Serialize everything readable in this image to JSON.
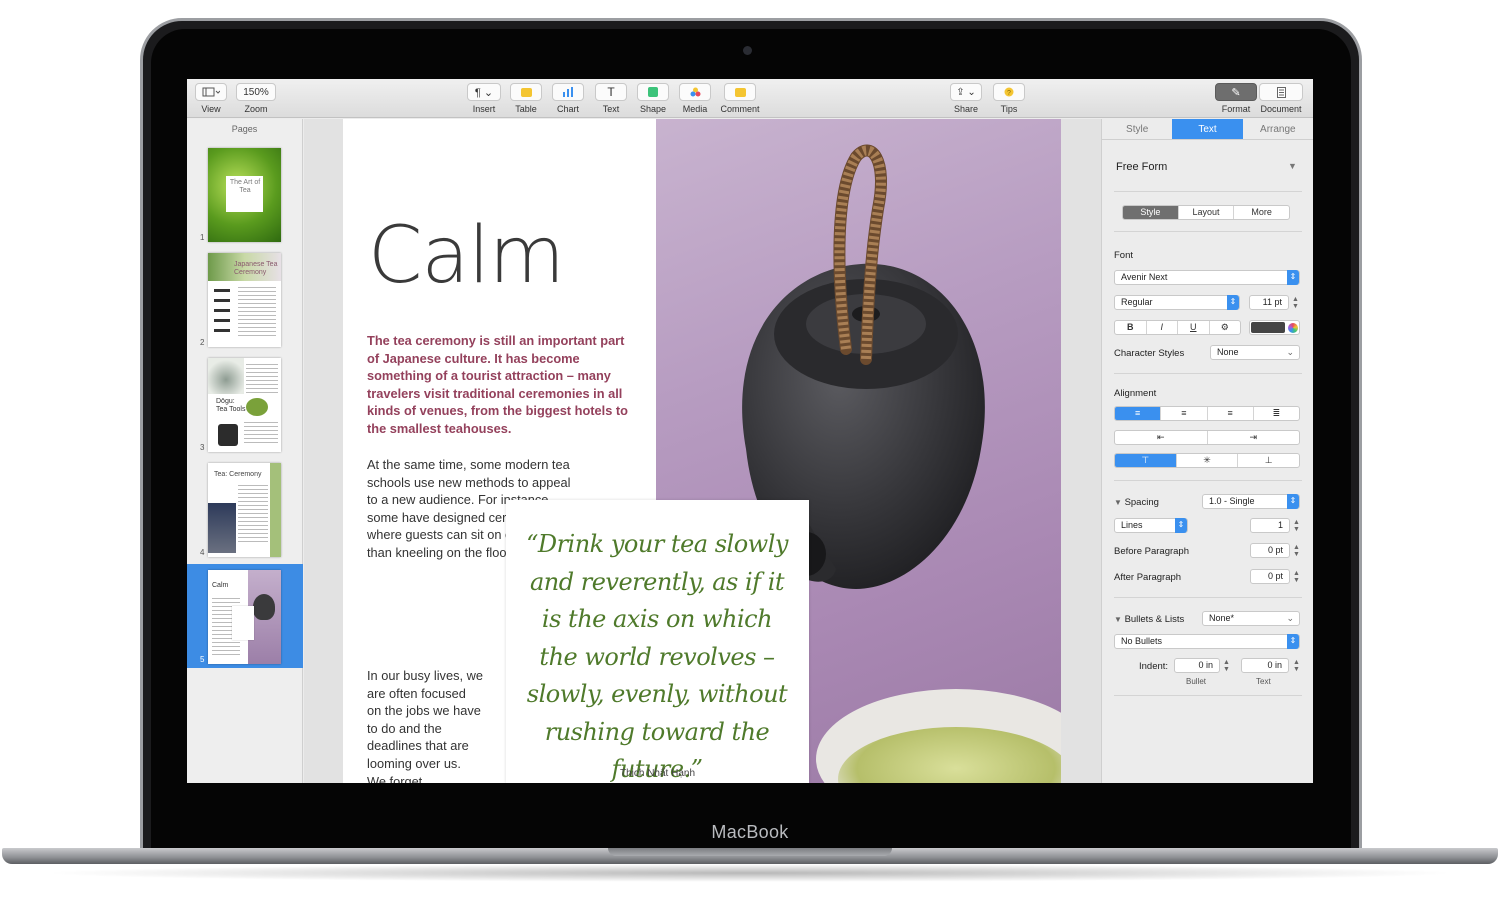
{
  "device": {
    "label": "MacBook"
  },
  "toolbar": {
    "view_label": "View",
    "zoom_value": "150%",
    "zoom_label": "Zoom",
    "insert_label": "Insert",
    "table_label": "Table",
    "chart_label": "Chart",
    "text_label": "Text",
    "shape_label": "Shape",
    "media_label": "Media",
    "comment_label": "Comment",
    "share_label": "Share",
    "tips_label": "Tips",
    "format_label": "Format",
    "document_label": "Document"
  },
  "pages": {
    "title": "Pages",
    "selected": 5,
    "items": [
      {
        "number": "1",
        "text": "The Art of Tea"
      },
      {
        "number": "2",
        "text": "Japanese Tea Ceremony"
      },
      {
        "number": "3",
        "text": "Dōgu: Tea Tools"
      },
      {
        "number": "4",
        "text": "Tea: Ceremony"
      },
      {
        "number": "5",
        "text": "Calm"
      }
    ]
  },
  "document": {
    "title": "Calm",
    "lead": "The tea ceremony is still an important part of Japanese culture. It has become something of a tourist attraction – many travelers visit traditional ceremonies in all kinds of venues, from the biggest hotels to the smallest teahouses.",
    "body_1": "At the same time, some modern tea schools use new methods to appeal to a new audience. For instance, some have designed ceremonies where guests can sit on chairs rather than kneeling on the floor.",
    "body_2": "In our busy lives, we are often focused on the jobs we have to do and the deadlines that are looming over us. We forget",
    "quote": "“Drink your tea slowly and reverently, as if it is the axis on which the world revolves – slowly, evenly, without rushing toward the future.”",
    "quote_author": "Thich Nhất Hạnh"
  },
  "inspector": {
    "tabs": [
      "Style",
      "Text",
      "Arrange"
    ],
    "active_tab": "Text",
    "paragraph_style": "Free Form",
    "subtabs": [
      "Style",
      "Layout",
      "More"
    ],
    "font_label": "Font",
    "font_name": "Avenir Next",
    "font_weight": "Regular",
    "font_size": "11 pt",
    "bold": "B",
    "italic": "I",
    "underline": "U",
    "gear": "⚙",
    "char_styles_label": "Character Styles",
    "char_styles_value": "None",
    "alignment_label": "Alignment",
    "spacing_label": "Spacing",
    "spacing_value": "1.0 - Single",
    "lines_value": "Lines",
    "lines_number": "1",
    "before_label": "Before Paragraph",
    "before_value": "0 pt",
    "after_label": "After Paragraph",
    "after_value": "0 pt",
    "bullets_label": "Bullets & Lists",
    "bullets_value": "None*",
    "bullets_type": "No Bullets",
    "indent_label": "Indent:",
    "bullet_indent": "0 in",
    "text_indent": "0 in",
    "bullet_caption": "Bullet",
    "text_caption": "Text"
  },
  "colors": {
    "accent": "#3a90ef",
    "lead_text": "#94415c",
    "quote_text": "#4f7a2b"
  }
}
